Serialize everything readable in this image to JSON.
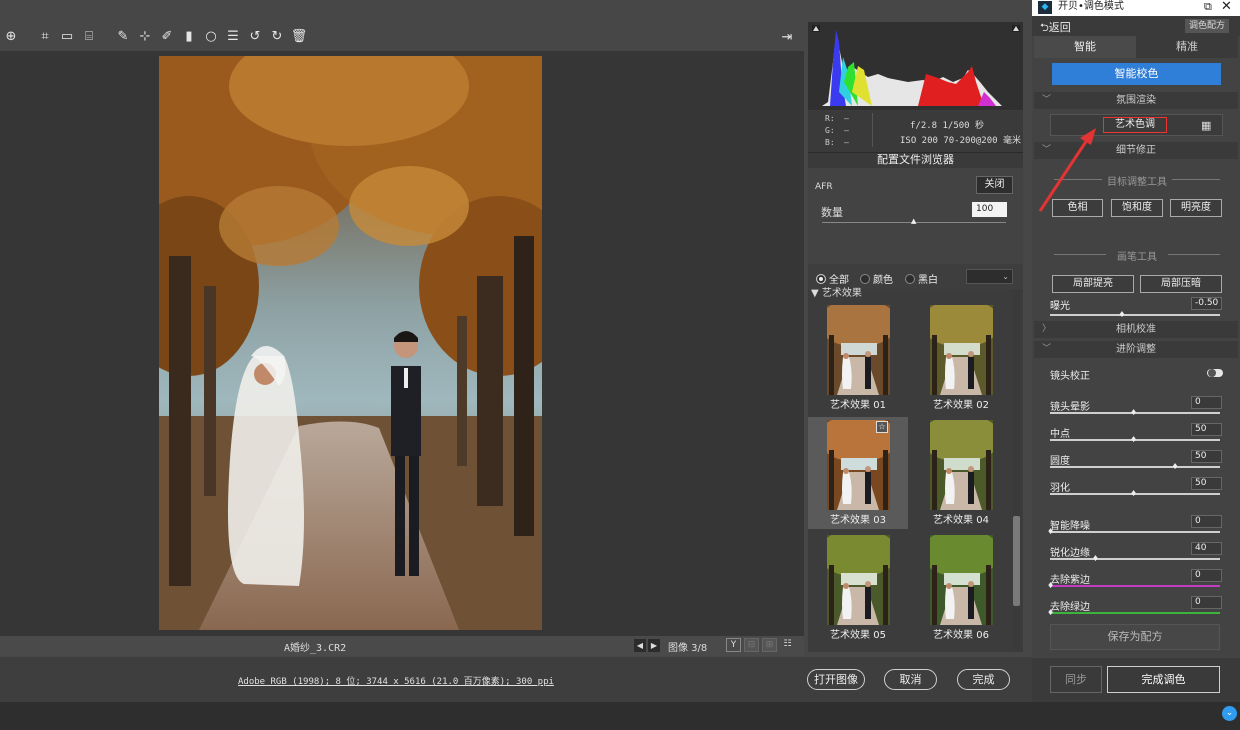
{
  "window": {
    "title": "开贝•调色模式",
    "restore_icon": "restore-icon",
    "close_icon": "close-icon"
  },
  "toolbar": {
    "icons": [
      "zoom-tool-icon",
      "crop-icon",
      "straighten-icon",
      "transform-icon",
      "spot-heal-icon",
      "red-eye-icon",
      "brush-icon",
      "graduated-filter-icon",
      "radial-filter-icon",
      "list-icon",
      "rotate-left-icon",
      "rotate-right-icon",
      "trash-icon"
    ],
    "export_icon": "export-icon"
  },
  "file": {
    "name": "A婚纱_3.CR2",
    "page": "图像 3/8",
    "color_info": "Adobe RGB (1998); 8 位; 3744 x 5616 (21.0 百万像素); 300 ppi"
  },
  "bottom_buttons": {
    "open": "打开图像",
    "cancel": "取消",
    "done": "完成"
  },
  "histogram": {
    "r_label": "R:",
    "g_label": "G:",
    "b_label": "B:",
    "r_value": "—",
    "g_value": "—",
    "b_value": "—",
    "aperture_shutter": "f/2.8   1/500 秒",
    "iso_lens": "ISO 200   70-200@200 毫米"
  },
  "profile_browser": {
    "title": "配置文件浏览器",
    "profile_name": "AFR",
    "close_label": "关闭",
    "amount_label": "数量",
    "amount_value": "100",
    "amount_fraction": 0.5
  },
  "filter": {
    "options": [
      "全部",
      "颜色",
      "黑白"
    ],
    "selected": "全部",
    "select_value": "⌄"
  },
  "thumbnails": {
    "group_label": "▼ 艺术效果",
    "items": [
      "艺术效果 01",
      "艺术效果 02",
      "艺术效果 03",
      "艺术效果 04",
      "艺术效果 05",
      "艺术效果 06"
    ],
    "selected_index": 2
  },
  "panel": {
    "back": "⮌返回",
    "recipe": "调色配方",
    "tabs": [
      "智能",
      "精准"
    ],
    "smart_button": "智能校色",
    "section_atmosphere": "氛围渲染",
    "art_tone": "艺术色调",
    "section_detail": "细节修正",
    "target_tool": "目标调整工具",
    "hue": "色相",
    "saturation": "饱和度",
    "brightness": "明亮度",
    "brush_tool": "画笔工具",
    "local_boost": "局部提亮",
    "local_darken": "局部压暗",
    "exposure_label": "曝光",
    "exposure_value": "-0.50",
    "exposure_fraction": 0.43,
    "section_camera": "相机校准",
    "section_advanced": "进阶调整",
    "lens_correction": "镜头校正",
    "sliders": [
      {
        "label": "镜头晕影",
        "value": "0",
        "fraction": 0.5
      },
      {
        "label": "中点",
        "value": "50",
        "fraction": 0.5
      },
      {
        "label": "圆度",
        "value": "50",
        "fraction": 0.75
      },
      {
        "label": "羽化",
        "value": "50",
        "fraction": 0.5
      }
    ],
    "sliders2": [
      {
        "label": "智能降噪",
        "value": "0",
        "fraction": 0.0
      },
      {
        "label": "锐化边缘",
        "value": "40",
        "fraction": 0.27
      },
      {
        "label": "去除紫边",
        "value": "0",
        "fraction": 0.0
      },
      {
        "label": "去除绿边",
        "value": "0",
        "fraction": 0.0
      }
    ],
    "save_recipe": "保存为配方",
    "sync": "同步",
    "finish": "完成调色"
  },
  "colors": {
    "accent_blue": "#2f7ed8",
    "highlight_red": "#e33333",
    "fringe_purple": "#c03cc0",
    "fringe_green": "#3cb43c"
  },
  "help_icon": "help-icon"
}
